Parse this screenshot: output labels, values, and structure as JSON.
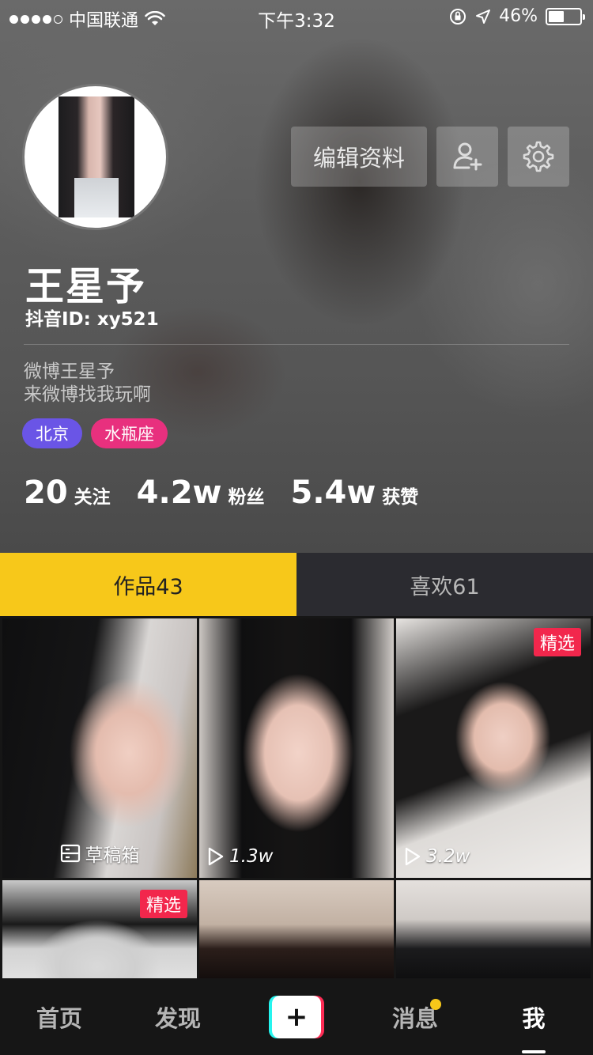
{
  "status_bar": {
    "carrier": "中国联通",
    "time": "下午3:32",
    "battery": "46%",
    "battery_level": 0.46
  },
  "profile": {
    "name": "王星予",
    "douyin_id": "抖音ID: xy521",
    "bio_line1": "微博王星予",
    "bio_line2": "来微博找我玩啊",
    "tags": [
      {
        "label": "北京",
        "color": "#6a55e6"
      },
      {
        "label": "水瓶座",
        "color": "#e8307e"
      }
    ],
    "edit_button": "编辑资料",
    "stats": {
      "following_num": "20",
      "following_label": "关注",
      "fans_num": "4.2w",
      "fans_label": "粉丝",
      "likes_num": "5.4w",
      "likes_label": "获赞"
    }
  },
  "tabs": {
    "works": "作品43",
    "likes": "喜欢61"
  },
  "grid": {
    "items": [
      {
        "footer": "草稿箱",
        "badge": ""
      },
      {
        "footer": "1.3w",
        "badge": ""
      },
      {
        "footer": "3.2w",
        "badge": "精选"
      },
      {
        "footer": "",
        "badge": "精选"
      },
      {
        "footer": "",
        "badge": ""
      },
      {
        "footer": "",
        "badge": ""
      }
    ]
  },
  "bottom_nav": {
    "home": "首页",
    "discover": "发现",
    "create": "+",
    "messages": "消息",
    "me": "我"
  },
  "colors": {
    "accent_yellow": "#f7c81a",
    "badge_red": "#f2274c"
  }
}
